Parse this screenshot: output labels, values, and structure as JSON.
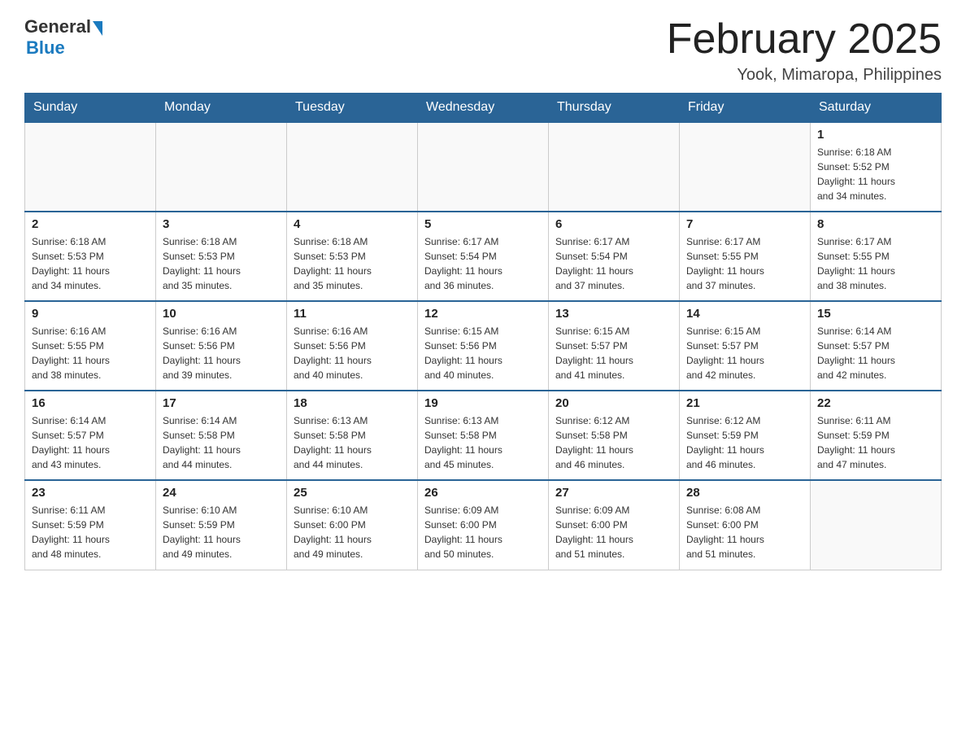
{
  "logo": {
    "general": "General",
    "blue": "Blue"
  },
  "title": "February 2025",
  "subtitle": "Yook, Mimaropa, Philippines",
  "weekdays": [
    "Sunday",
    "Monday",
    "Tuesday",
    "Wednesday",
    "Thursday",
    "Friday",
    "Saturday"
  ],
  "weeks": [
    [
      {
        "day": "",
        "info": ""
      },
      {
        "day": "",
        "info": ""
      },
      {
        "day": "",
        "info": ""
      },
      {
        "day": "",
        "info": ""
      },
      {
        "day": "",
        "info": ""
      },
      {
        "day": "",
        "info": ""
      },
      {
        "day": "1",
        "info": "Sunrise: 6:18 AM\nSunset: 5:52 PM\nDaylight: 11 hours\nand 34 minutes."
      }
    ],
    [
      {
        "day": "2",
        "info": "Sunrise: 6:18 AM\nSunset: 5:53 PM\nDaylight: 11 hours\nand 34 minutes."
      },
      {
        "day": "3",
        "info": "Sunrise: 6:18 AM\nSunset: 5:53 PM\nDaylight: 11 hours\nand 35 minutes."
      },
      {
        "day": "4",
        "info": "Sunrise: 6:18 AM\nSunset: 5:53 PM\nDaylight: 11 hours\nand 35 minutes."
      },
      {
        "day": "5",
        "info": "Sunrise: 6:17 AM\nSunset: 5:54 PM\nDaylight: 11 hours\nand 36 minutes."
      },
      {
        "day": "6",
        "info": "Sunrise: 6:17 AM\nSunset: 5:54 PM\nDaylight: 11 hours\nand 37 minutes."
      },
      {
        "day": "7",
        "info": "Sunrise: 6:17 AM\nSunset: 5:55 PM\nDaylight: 11 hours\nand 37 minutes."
      },
      {
        "day": "8",
        "info": "Sunrise: 6:17 AM\nSunset: 5:55 PM\nDaylight: 11 hours\nand 38 minutes."
      }
    ],
    [
      {
        "day": "9",
        "info": "Sunrise: 6:16 AM\nSunset: 5:55 PM\nDaylight: 11 hours\nand 38 minutes."
      },
      {
        "day": "10",
        "info": "Sunrise: 6:16 AM\nSunset: 5:56 PM\nDaylight: 11 hours\nand 39 minutes."
      },
      {
        "day": "11",
        "info": "Sunrise: 6:16 AM\nSunset: 5:56 PM\nDaylight: 11 hours\nand 40 minutes."
      },
      {
        "day": "12",
        "info": "Sunrise: 6:15 AM\nSunset: 5:56 PM\nDaylight: 11 hours\nand 40 minutes."
      },
      {
        "day": "13",
        "info": "Sunrise: 6:15 AM\nSunset: 5:57 PM\nDaylight: 11 hours\nand 41 minutes."
      },
      {
        "day": "14",
        "info": "Sunrise: 6:15 AM\nSunset: 5:57 PM\nDaylight: 11 hours\nand 42 minutes."
      },
      {
        "day": "15",
        "info": "Sunrise: 6:14 AM\nSunset: 5:57 PM\nDaylight: 11 hours\nand 42 minutes."
      }
    ],
    [
      {
        "day": "16",
        "info": "Sunrise: 6:14 AM\nSunset: 5:57 PM\nDaylight: 11 hours\nand 43 minutes."
      },
      {
        "day": "17",
        "info": "Sunrise: 6:14 AM\nSunset: 5:58 PM\nDaylight: 11 hours\nand 44 minutes."
      },
      {
        "day": "18",
        "info": "Sunrise: 6:13 AM\nSunset: 5:58 PM\nDaylight: 11 hours\nand 44 minutes."
      },
      {
        "day": "19",
        "info": "Sunrise: 6:13 AM\nSunset: 5:58 PM\nDaylight: 11 hours\nand 45 minutes."
      },
      {
        "day": "20",
        "info": "Sunrise: 6:12 AM\nSunset: 5:58 PM\nDaylight: 11 hours\nand 46 minutes."
      },
      {
        "day": "21",
        "info": "Sunrise: 6:12 AM\nSunset: 5:59 PM\nDaylight: 11 hours\nand 46 minutes."
      },
      {
        "day": "22",
        "info": "Sunrise: 6:11 AM\nSunset: 5:59 PM\nDaylight: 11 hours\nand 47 minutes."
      }
    ],
    [
      {
        "day": "23",
        "info": "Sunrise: 6:11 AM\nSunset: 5:59 PM\nDaylight: 11 hours\nand 48 minutes."
      },
      {
        "day": "24",
        "info": "Sunrise: 6:10 AM\nSunset: 5:59 PM\nDaylight: 11 hours\nand 49 minutes."
      },
      {
        "day": "25",
        "info": "Sunrise: 6:10 AM\nSunset: 6:00 PM\nDaylight: 11 hours\nand 49 minutes."
      },
      {
        "day": "26",
        "info": "Sunrise: 6:09 AM\nSunset: 6:00 PM\nDaylight: 11 hours\nand 50 minutes."
      },
      {
        "day": "27",
        "info": "Sunrise: 6:09 AM\nSunset: 6:00 PM\nDaylight: 11 hours\nand 51 minutes."
      },
      {
        "day": "28",
        "info": "Sunrise: 6:08 AM\nSunset: 6:00 PM\nDaylight: 11 hours\nand 51 minutes."
      },
      {
        "day": "",
        "info": ""
      }
    ]
  ]
}
